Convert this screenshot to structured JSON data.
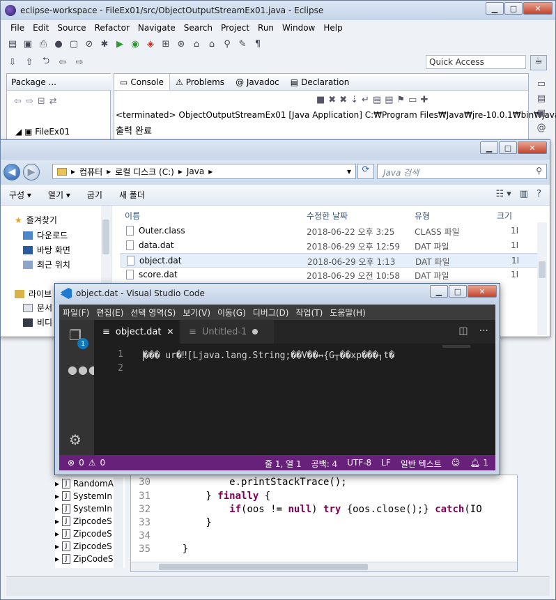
{
  "eclipse": {
    "title": "eclipse-workspace - FileEx01/src/ObjectOutputStreamEx01.java - Eclipse",
    "menu": [
      "File",
      "Edit",
      "Source",
      "Refactor",
      "Navigate",
      "Search",
      "Project",
      "Run",
      "Window",
      "Help"
    ],
    "quick_access": "Quick Access",
    "package_explorer": {
      "tab": "Package ...",
      "project": "FileEx01"
    },
    "console": {
      "tabs": [
        "Console",
        "Problems",
        "@ Javadoc",
        "Declaration"
      ],
      "status": "<terminated> ObjectOutputStreamEx01 [Java Application] C:₩Program Files₩Java₩jre-10.0.1₩bin₩javaw.exe",
      "output": "출력 완료"
    },
    "side_list": [
      "RandomA",
      "SystemIn",
      "SystemIn",
      "ZipcodeS",
      "ZipcodeS",
      "ZipcodeS",
      "ZipCodeS"
    ],
    "code": [
      {
        "ln": "30",
        "text": "            e.printStackTrace();"
      },
      {
        "ln": "31",
        "pre": "        } ",
        "kw": "finally",
        "post": " {"
      },
      {
        "ln": "32",
        "pre": "            ",
        "kw": "if",
        "post": "(oos != ",
        "kw2": "null",
        "post2": ") ",
        "kw3": "try",
        "post3": " {oos.close();} ",
        "kw4": "catch",
        "post4": "(IO"
      },
      {
        "ln": "33",
        "text": "        }"
      },
      {
        "ln": "34",
        "text": ""
      },
      {
        "ln": "35",
        "text": "    }"
      }
    ]
  },
  "explorer": {
    "breadcrumb": [
      "컴퓨터",
      "로컬 디스크 (C:)",
      "Java"
    ],
    "search_placeholder": "Java 검색",
    "commands": [
      "구성 ▾",
      "열기 ▾",
      "굽기",
      "새 폴더"
    ],
    "nav": {
      "favorites": "즐겨찾기",
      "items": [
        "다운로드",
        "바탕 화면",
        "최근 위치"
      ],
      "libraries": "라이브",
      "lib_items": [
        "문서",
        "비디"
      ]
    },
    "columns": {
      "name": "이름",
      "date": "수정한 날짜",
      "type": "유형",
      "size": "크기"
    },
    "files": [
      {
        "name": "Outer.class",
        "date": "2018-06-22 오후 3:25",
        "type": "CLASS 파일",
        "size": "1I"
      },
      {
        "name": "data.dat",
        "date": "2018-06-29 오후 12:59",
        "type": "DAT 파일",
        "size": "1I"
      },
      {
        "name": "object.dat",
        "date": "2018-06-29 오후 1:13",
        "type": "DAT 파일",
        "size": "1I"
      },
      {
        "name": "score.dat",
        "date": "2018-06-29 오전 10:58",
        "type": "DAT 파일",
        "size": "1I"
      }
    ]
  },
  "vscode": {
    "title": "object.dat - Visual Studio Code",
    "menu": [
      "파일(F)",
      "편집(E)",
      "선택 영역(S)",
      "보기(V)",
      "이동(G)",
      "디버그(D)",
      "작업(T)",
      "도움말(H)"
    ],
    "explorer_badge": "1",
    "tabs": {
      "active": "object.dat",
      "inactive": "Untitled-1"
    },
    "line_numbers": [
      "1",
      "2"
    ],
    "content": "��� ur�‼[Ljava.lang.String;��V��↔{G┬��xp���┐t�",
    "status": {
      "errors": "0",
      "warnings": "0",
      "position": "줄 1, 열 1",
      "spaces": "공백: 4",
      "encoding": "UTF-8",
      "eol": "LF",
      "language": "일반 텍스트",
      "bell_count": "1"
    }
  }
}
